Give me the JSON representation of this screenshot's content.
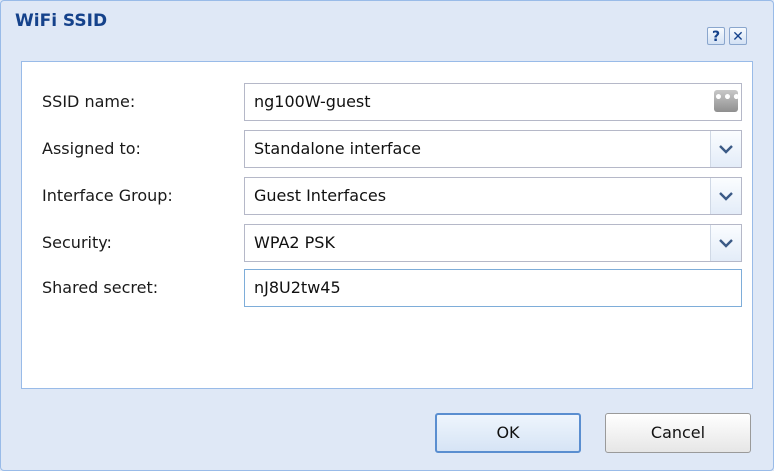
{
  "dialog": {
    "title": "WiFi SSID",
    "help_glyph": "?",
    "close_glyph": "✕"
  },
  "form": {
    "ssid": {
      "label": "SSID name:",
      "value": "ng100W-guest",
      "button_glyph": "•••"
    },
    "assigned_to": {
      "label": "Assigned to:",
      "value": "Standalone interface"
    },
    "interface_group": {
      "label": "Interface Group:",
      "value": "Guest Interfaces"
    },
    "security": {
      "label": "Security:",
      "value": "WPA2 PSK"
    },
    "shared_secret": {
      "label": "Shared secret:",
      "value": "nJ8U2tw45"
    }
  },
  "buttons": {
    "ok": "OK",
    "cancel": "Cancel"
  },
  "icons": [
    "help-icon",
    "close-icon",
    "ellipsis-icon",
    "chevron-down-icon"
  ],
  "colors": {
    "window_bg": "#dfe8f6",
    "title_text": "#15428b",
    "panel_border": "#99bbe8",
    "focus_border": "#7eadd9"
  }
}
